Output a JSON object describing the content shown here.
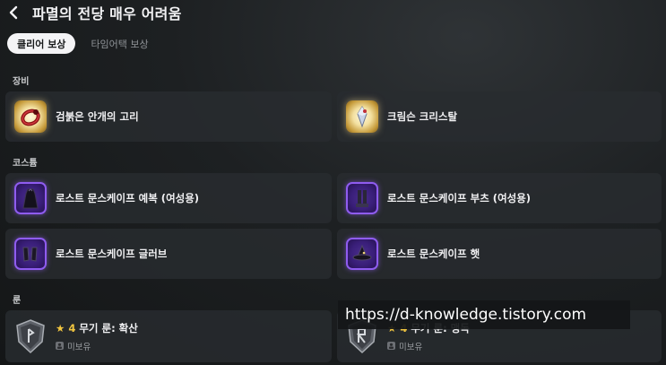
{
  "header": {
    "title": "파멸의 전당 매우 어려움",
    "back_icon": "chevron-left-icon"
  },
  "tabs": [
    {
      "label": "클리어 보상",
      "active": true
    },
    {
      "label": "타임어택 보상",
      "active": false
    }
  ],
  "sections": {
    "equipment": {
      "label": "장비",
      "items": [
        {
          "name": "검붉은 안개의 고리",
          "icon": "ring-icon",
          "rarity": "legendary"
        },
        {
          "name": "크림슨 크리스탈",
          "icon": "crystal-icon",
          "rarity": "legendary"
        }
      ]
    },
    "costume": {
      "label": "코스튬",
      "items": [
        {
          "name": "로스트 문스케이프 예복 (여성용)",
          "icon": "robe-icon",
          "rarity": "epic"
        },
        {
          "name": "로스트 문스케이프 부츠 (여성용)",
          "icon": "boots-icon",
          "rarity": "epic"
        },
        {
          "name": "로스트 문스케이프 글러브",
          "icon": "gloves-icon",
          "rarity": "epic"
        },
        {
          "name": "로스트 문스케이프 햇",
          "icon": "hat-icon",
          "rarity": "epic"
        }
      ]
    },
    "rune": {
      "label": "룬",
      "items": [
        {
          "star": "★",
          "tier": "4",
          "name": "무기 룬: 확산",
          "owned": "미보유",
          "icon": "rune-shield-icon"
        },
        {
          "star": "★",
          "tier": "4",
          "name": "무기 룬: 맹독",
          "owned": "미보유",
          "icon": "rune-shield-icon"
        }
      ]
    }
  },
  "watermark": "https://d-knowledge.tistory.com",
  "colors": {
    "legendary_glow": "#f3e0a0",
    "epic_border": "#8f5cf0",
    "star": "#f2c640"
  }
}
